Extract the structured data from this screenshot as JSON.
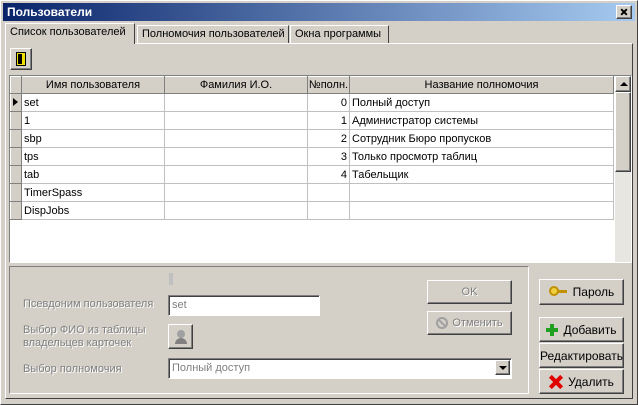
{
  "window": {
    "title": "Пользователи"
  },
  "tabs": [
    {
      "label": "Список пользователей",
      "active": true
    },
    {
      "label": "Полномочия пользователей",
      "active": false
    },
    {
      "label": "Окна программы",
      "active": false
    }
  ],
  "grid": {
    "columns": [
      "Имя пользователя",
      "Фамилия И.О.",
      "№полн.",
      "Название полномочия"
    ],
    "rows": [
      {
        "user": "set",
        "fio": "",
        "num": "0",
        "permission": "Полный доступ",
        "current": true
      },
      {
        "user": "1",
        "fio": "",
        "num": "1",
        "permission": "Администратор системы"
      },
      {
        "user": "sbp",
        "fio": "",
        "num": "2",
        "permission": "Сотрудник Бюро пропусков"
      },
      {
        "user": "tps",
        "fio": "",
        "num": "3",
        "permission": "Только просмотр таблиц"
      },
      {
        "user": "tab",
        "fio": "",
        "num": "4",
        "permission": "Табельщик"
      },
      {
        "user": "TimerSpass",
        "fio": "",
        "num": "",
        "permission": ""
      },
      {
        "user": "DispJobs",
        "fio": "",
        "num": "",
        "permission": ""
      }
    ]
  },
  "form": {
    "alias_label": "Псевдоним пользователя",
    "alias_value": "set",
    "fio_label_line1": "Выбор ФИО из таблицы",
    "fio_label_line2": "владельцев карточек",
    "permission_label": "Выбор полномочия",
    "permission_value": "Полный доступ",
    "ok_label": "OK",
    "cancel_label": "Отменить"
  },
  "side_buttons": {
    "password_label": "Пароль",
    "add_label": "Добавить",
    "edit_label": "Редактировать",
    "delete_label": "Удалить"
  },
  "icons": {
    "exit": "exit-door-icon",
    "password": "key-icon",
    "add": "plus-icon",
    "delete": "x-icon",
    "cancel": "no-entry-icon",
    "fio": "person-icon"
  },
  "colors": {
    "title_start": "#0a246a",
    "title_end": "#a6caf0",
    "face": "#d4d0c8"
  }
}
